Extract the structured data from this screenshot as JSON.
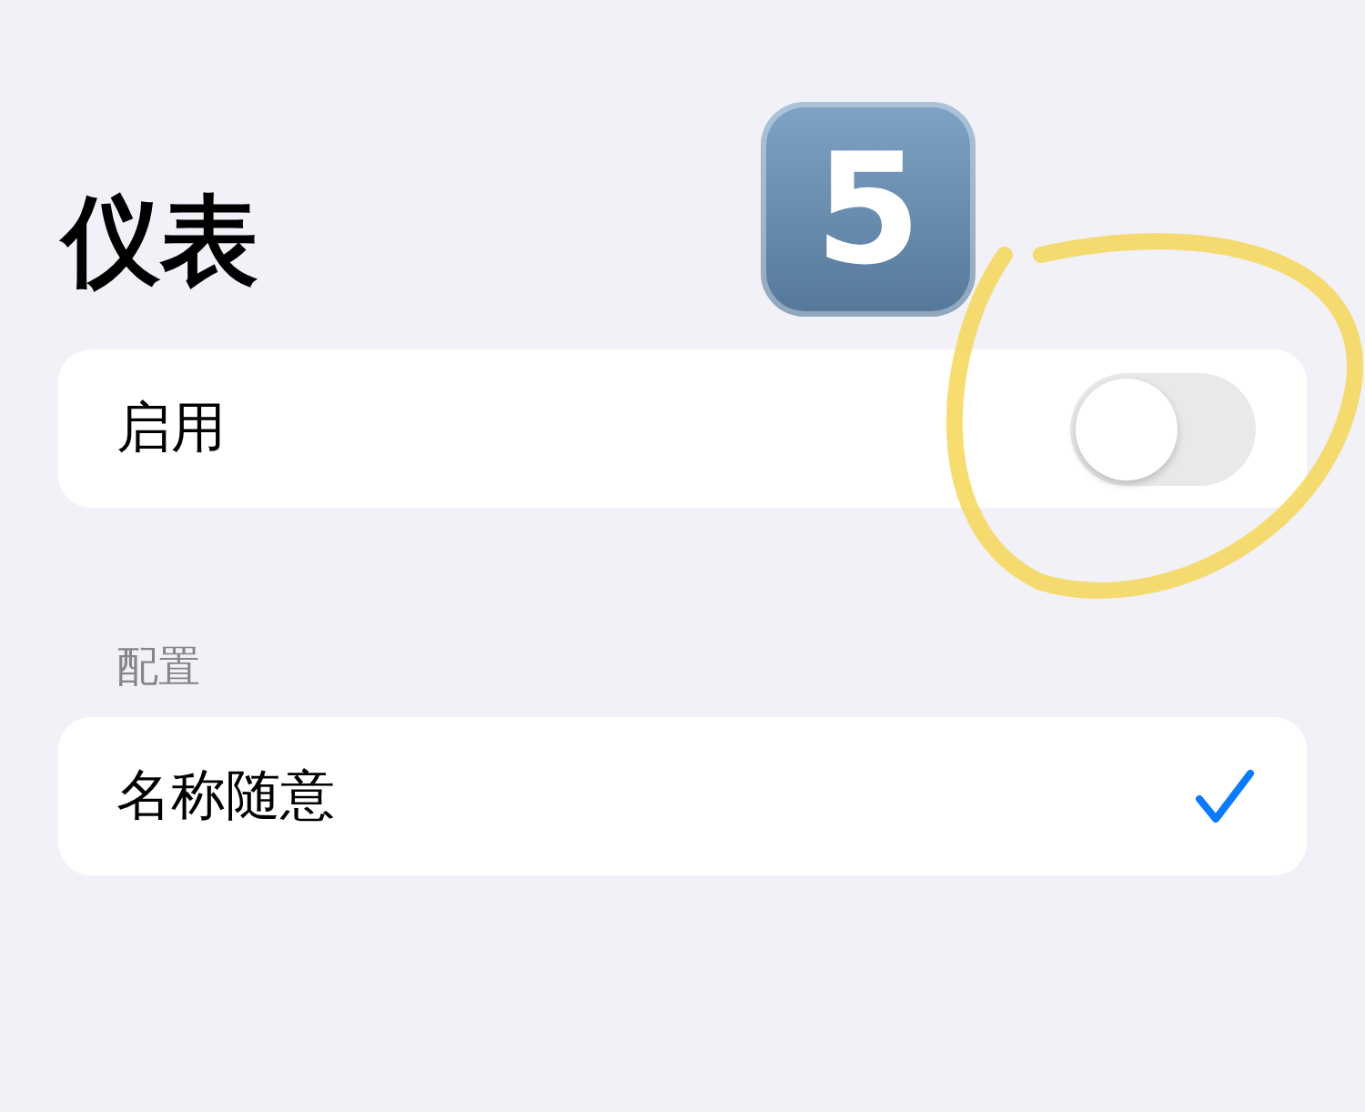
{
  "title": "仪表",
  "annotation": {
    "step_badge": "5",
    "highlight": true
  },
  "settings": [
    {
      "label": "启用",
      "kind": "toggle",
      "on": false
    }
  ],
  "section": {
    "header": "配置",
    "items": [
      {
        "label": "名称随意",
        "selected": true
      }
    ]
  }
}
